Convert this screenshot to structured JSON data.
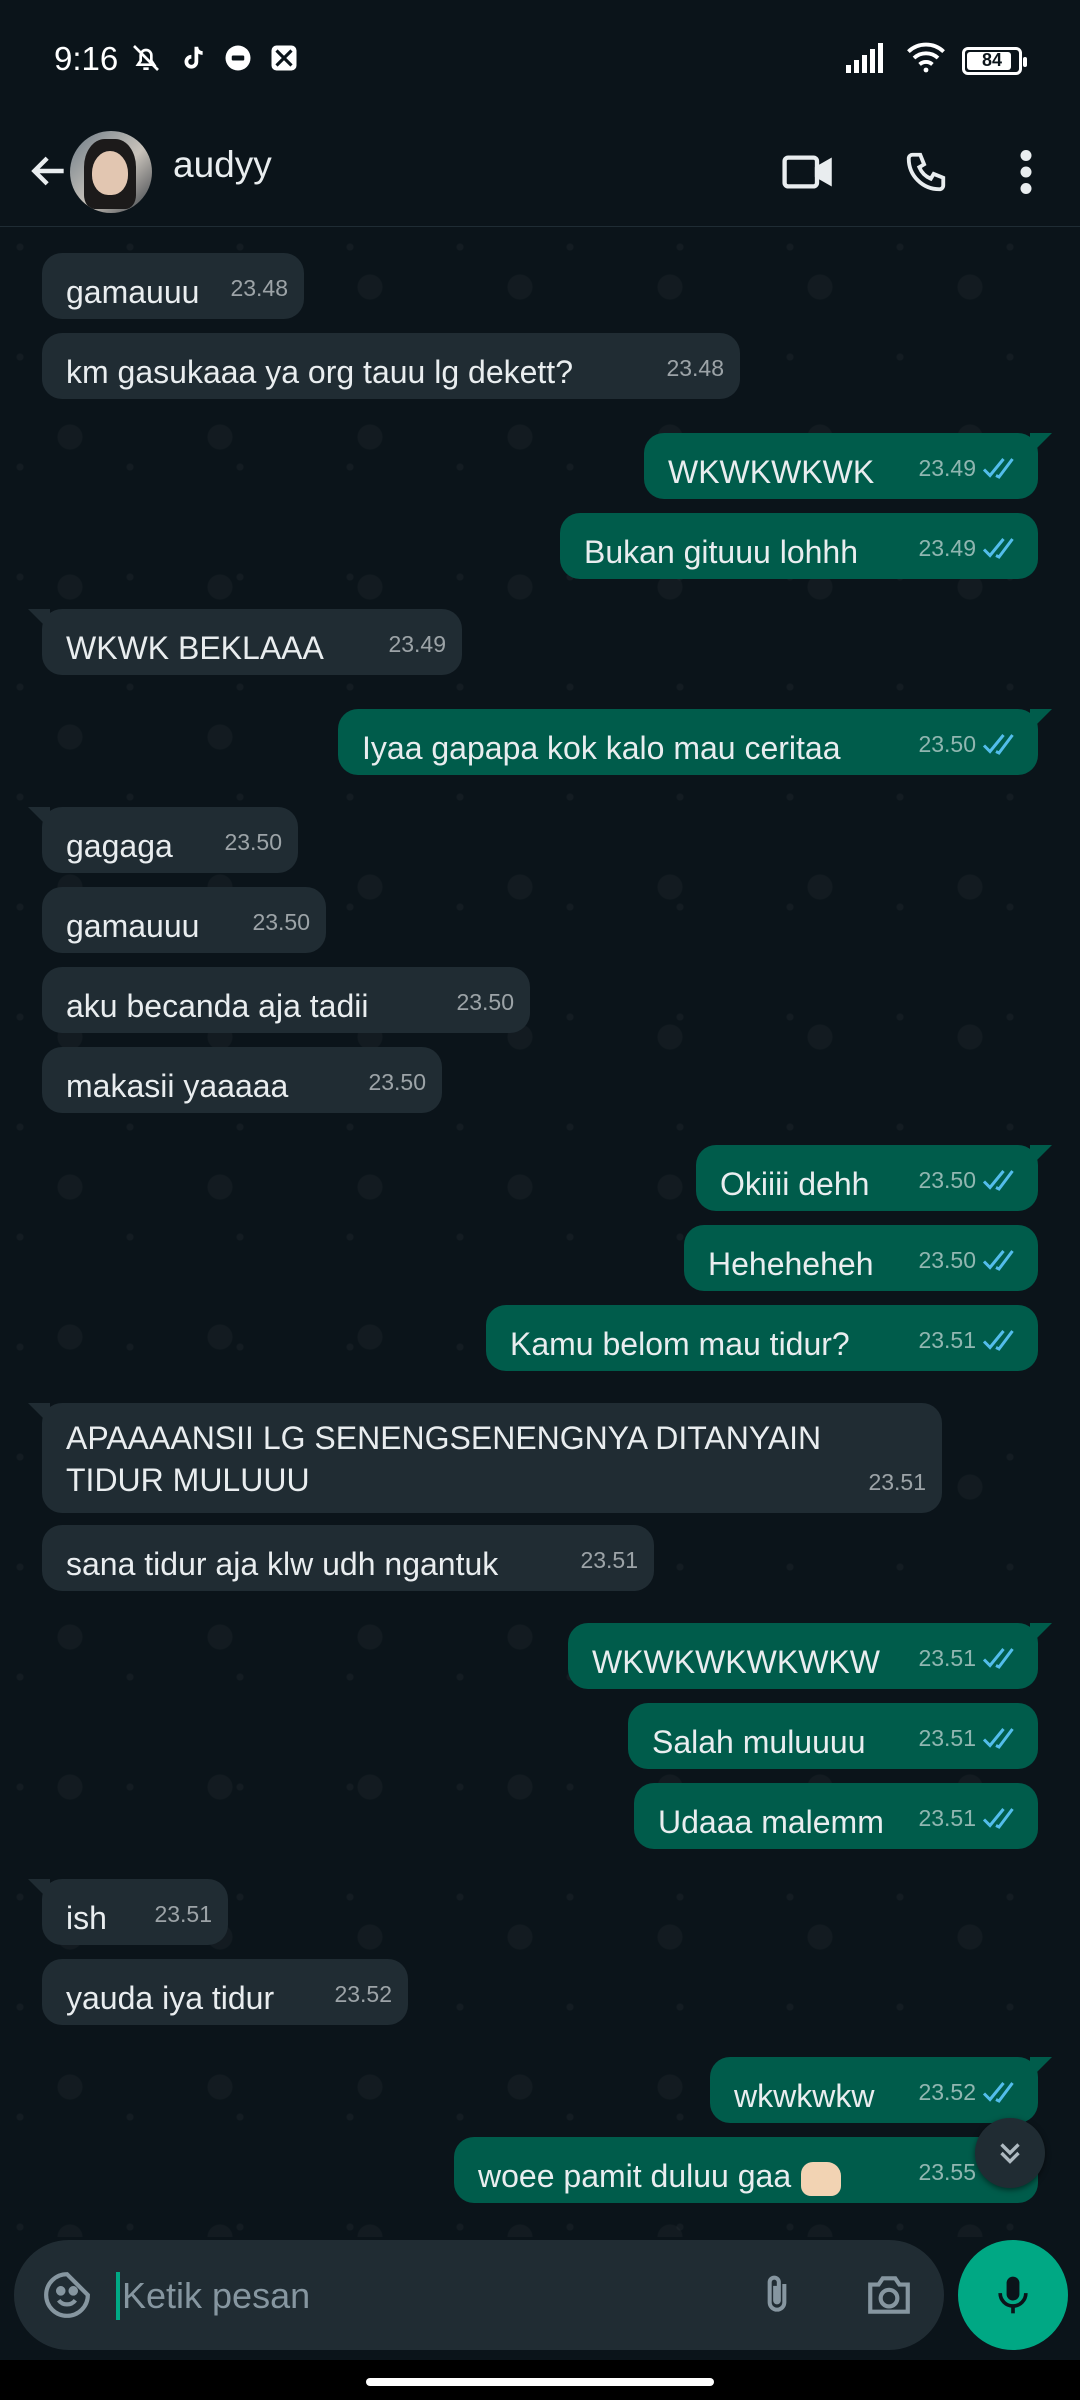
{
  "status_bar": {
    "time": "9:16",
    "battery": "84",
    "battery_level": 0.84
  },
  "header": {
    "contact_name": "audyy"
  },
  "messages": [
    {
      "dir": "in",
      "text": "gamauuu",
      "time": "23.48"
    },
    {
      "dir": "in",
      "text": "km gasukaaa ya org tauu lg dekett?",
      "time": "23.48"
    },
    {
      "dir": "out",
      "text": "WKWKWKWK",
      "time": "23.49"
    },
    {
      "dir": "out",
      "text": "Bukan gituuu lohhh",
      "time": "23.49"
    },
    {
      "dir": "in",
      "text": "WKWK BEKLAAA",
      "time": "23.49"
    },
    {
      "dir": "out",
      "text": "Iyaa gapapa kok kalo mau ceritaa",
      "time": "23.50"
    },
    {
      "dir": "in",
      "text": "gagaga",
      "time": "23.50"
    },
    {
      "dir": "in",
      "text": "gamauuu",
      "time": "23.50"
    },
    {
      "dir": "in",
      "text": "aku becanda aja tadii",
      "time": "23.50"
    },
    {
      "dir": "in",
      "text": "makasii yaaaaa",
      "time": "23.50"
    },
    {
      "dir": "out",
      "text": "Okiiii dehh",
      "time": "23.50"
    },
    {
      "dir": "out",
      "text": "Heheheheh",
      "time": "23.50"
    },
    {
      "dir": "out",
      "text": "Kamu belom mau tidur?",
      "time": "23.51"
    },
    {
      "dir": "in",
      "text": "APAAAANSII LG SENENGSENENGNYA DITANYAIN\nTIDUR MULUUU",
      "time": "23.51"
    },
    {
      "dir": "in",
      "text": "sana tidur aja klw udh ngantuk",
      "time": "23.51"
    },
    {
      "dir": "out",
      "text": "WKWKWKWKWKW",
      "time": "23.51"
    },
    {
      "dir": "out",
      "text": "Salah muluuuu",
      "time": "23.51"
    },
    {
      "dir": "out",
      "text": "Udaaa malemm",
      "time": "23.51"
    },
    {
      "dir": "in",
      "text": "ish",
      "time": "23.51"
    },
    {
      "dir": "in",
      "text": "yauda iya tidur",
      "time": "23.52"
    },
    {
      "dir": "out",
      "text": "wkwkwkw",
      "time": "23.52"
    },
    {
      "dir": "out",
      "text": "woee pamit duluu gaa",
      "time": "23.55",
      "emoji": "fist-bump"
    }
  ],
  "input": {
    "placeholder": "Ketik pesan",
    "value": ""
  },
  "icons": {
    "back": "arrow-left-icon",
    "video": "video-call-icon",
    "call": "phone-icon",
    "menu": "more-vert-icon",
    "emoji": "sticker-icon",
    "attach": "paperclip-icon",
    "camera": "camera-icon",
    "mic": "microphone-icon",
    "scroll": "double-chevron-down-icon",
    "read": "double-check-icon"
  },
  "colors": {
    "background": "#0b141a",
    "incoming_bubble": "#202c33",
    "outgoing_bubble": "#005c4b",
    "accent": "#00a884",
    "read_tick": "#53bdeb"
  }
}
